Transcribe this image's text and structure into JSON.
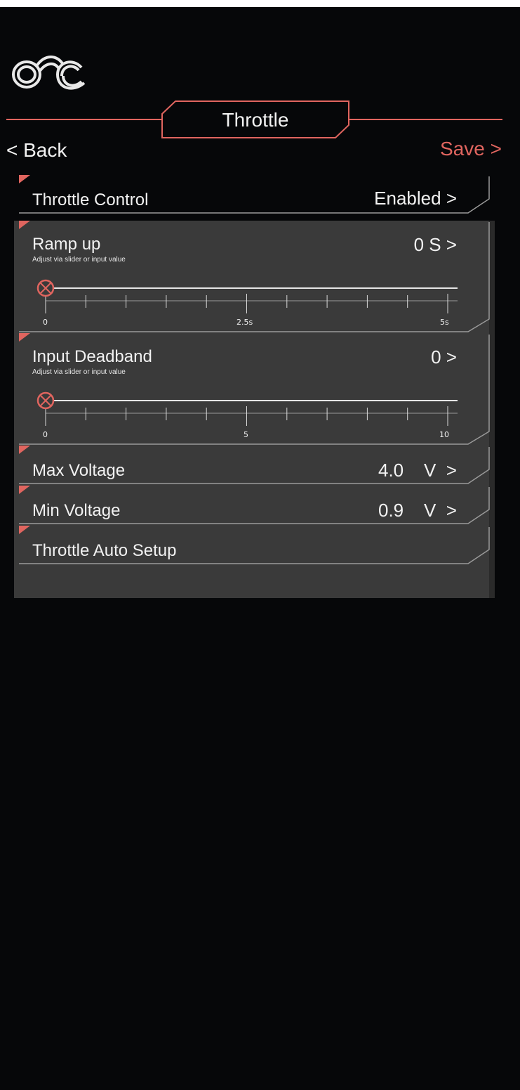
{
  "colors": {
    "accent": "#e0655f",
    "background": "#060709",
    "panel": "#3a3a3a",
    "line": "#bdbdbd"
  },
  "header": {
    "logo_icon": "rider-logo-icon",
    "title": "Throttle",
    "back_label": "< Back",
    "save_label": "Save >"
  },
  "settings": {
    "throttle_control": {
      "label": "Throttle Control",
      "value": "Enabled  >"
    },
    "ramp_up": {
      "label": "Ramp up",
      "hint": "Adjust via slider or input value",
      "value": "0 S  >",
      "slider": {
        "min": 0,
        "max": 5,
        "current": 0,
        "tick_labels": [
          "0",
          "2.5s",
          "5s"
        ]
      }
    },
    "input_deadband": {
      "label": "Input Deadband",
      "hint": "Adjust via slider or input value",
      "value": "0  >",
      "slider": {
        "min": 0,
        "max": 10,
        "current": 0,
        "tick_labels": [
          "0",
          "5",
          "10"
        ]
      }
    },
    "max_voltage": {
      "label": "Max Voltage",
      "value": "4.0    V  >"
    },
    "min_voltage": {
      "label": "Min Voltage",
      "value": "0.9    V  >"
    },
    "auto_setup": {
      "label": "Throttle Auto Setup"
    }
  }
}
